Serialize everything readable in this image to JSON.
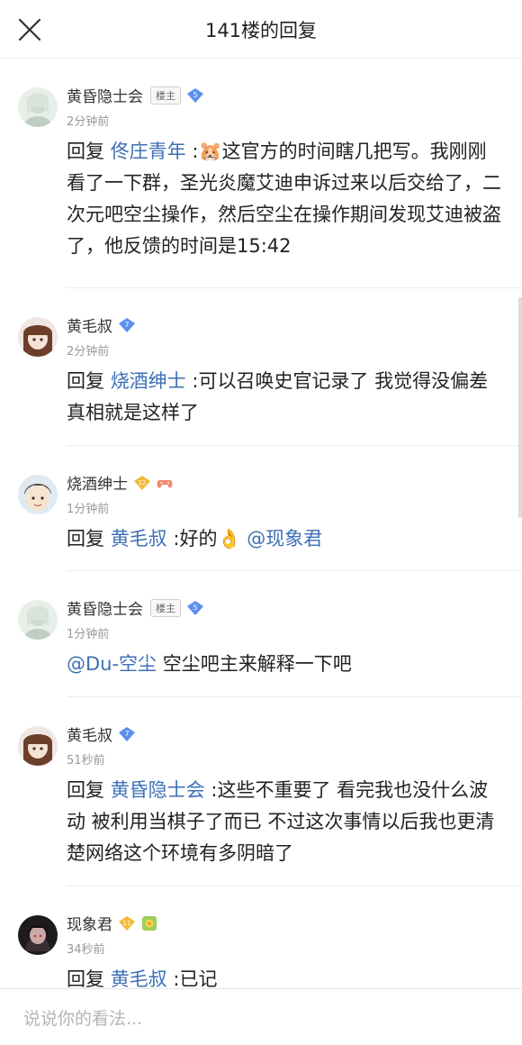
{
  "header": {
    "title": "141楼的回复"
  },
  "replies": [
    {
      "name": "黄昏隐士会",
      "owner_badge": "楼主",
      "level": "5",
      "level_color": "#5b8ff0",
      "time": "2分钟前",
      "prefix": "回复",
      "mention": "佟庄青年",
      "text": " :🐹这官方的时间瞎几把写。我刚刚看了一下群，圣光炎魔艾迪申诉过来以后交给了，二次元吧空尘操作，然后空尘在操作期间发现艾迪被盗了，他反馈的时间是15:42",
      "avatar": "avatar-anime-white"
    },
    {
      "name": "黄毛叔",
      "level": "7",
      "level_color": "#5b8ff0",
      "time": "2分钟前",
      "prefix": "回复",
      "mention": "烧酒绅士",
      "text": " :可以召唤史官记录了 我觉得没偏差真相就是这样了",
      "avatar": "avatar-anime-girl"
    },
    {
      "name": "烧酒绅士",
      "level": "12",
      "level_color": "#f0b93a",
      "time": "1分钟前",
      "prefix": "回复",
      "mention": "黄毛叔",
      "text": " :好的👌",
      "mention2": "@现象君",
      "avatar": "avatar-anime-boy"
    },
    {
      "name": "黄昏隐士会",
      "owner_badge": "楼主",
      "level": "5",
      "level_color": "#5b8ff0",
      "time": "1分钟前",
      "mention_lead": "@Du-空尘",
      "text": "  空尘吧主来解释一下吧",
      "avatar": "avatar-anime-white"
    },
    {
      "name": "黄毛叔",
      "level": "7",
      "level_color": "#5b8ff0",
      "time": "51秒前",
      "prefix": "回复",
      "mention": "黄昏隐士会",
      "text": " :这些不重要了 看完我也没什么波动 被利用当棋子了而已 不过这次事情以后我也更清楚网络这个环境有多阴暗了",
      "avatar": "avatar-anime-girl"
    },
    {
      "name": "现象君",
      "level": "11",
      "level_color": "#f0b93a",
      "time": "34秒前",
      "prefix": "回复",
      "mention": "黄毛叔",
      "text": " :已记",
      "avatar": "avatar-dark"
    }
  ],
  "input": {
    "placeholder": "说说你的看法..."
  }
}
